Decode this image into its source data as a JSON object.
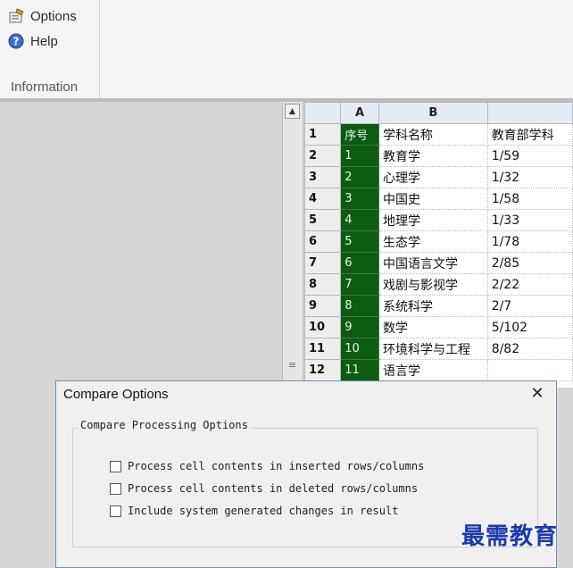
{
  "ribbon": {
    "options_label": "Options",
    "help_label": "Help",
    "group_label": "Information"
  },
  "sheet": {
    "columns": [
      "A",
      "B",
      ""
    ],
    "rows": [
      {
        "n": "1",
        "a": "序号",
        "b": "学科名称",
        "c": "教育部学科"
      },
      {
        "n": "2",
        "a": "1",
        "b": "教育学",
        "c": "1/59"
      },
      {
        "n": "3",
        "a": "2",
        "b": "心理学",
        "c": "1/32"
      },
      {
        "n": "4",
        "a": "3",
        "b": "中国史",
        "c": "1/58"
      },
      {
        "n": "5",
        "a": "4",
        "b": "地理学",
        "c": "1/33"
      },
      {
        "n": "6",
        "a": "5",
        "b": "生态学",
        "c": "1/78"
      },
      {
        "n": "7",
        "a": "6",
        "b": "中国语言文学",
        "c": "2/85"
      },
      {
        "n": "8",
        "a": "7",
        "b": "戏剧与影视学",
        "c": "2/22"
      },
      {
        "n": "9",
        "a": "8",
        "b": "系统科学",
        "c": "2/7"
      },
      {
        "n": "10",
        "a": "9",
        "b": "数学",
        "c": "5/102"
      },
      {
        "n": "11",
        "a": "10",
        "b": "环境科学与工程",
        "c": "8/82"
      },
      {
        "n": "12",
        "a": "11",
        "b": "语言学",
        "c": ""
      }
    ],
    "accent_color": "#0e5b12"
  },
  "dialog": {
    "title": "Compare Options",
    "close_glyph": "✕",
    "section_label": "Compare Processing Options",
    "options": [
      {
        "label": "Process cell contents in inserted rows/columns",
        "checked": false
      },
      {
        "label": "Process cell contents in deleted rows/columns",
        "checked": false
      },
      {
        "label": "Include system generated changes in result",
        "checked": false
      }
    ]
  },
  "watermark": "最需教育"
}
